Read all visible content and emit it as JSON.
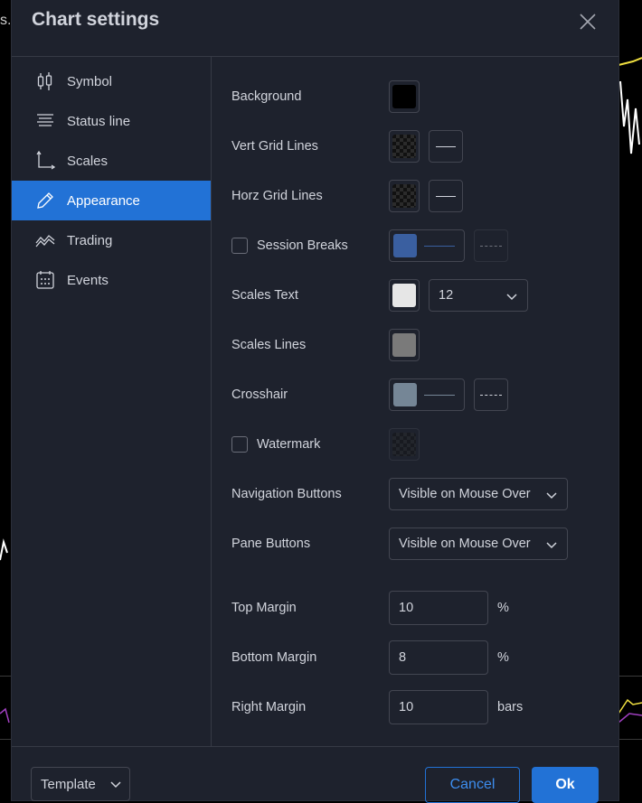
{
  "background_edge_text": "s.c",
  "dialog": {
    "title": "Chart settings"
  },
  "sidebar": {
    "items": [
      {
        "label": "Symbol",
        "icon": "candlestick-icon"
      },
      {
        "label": "Status line",
        "icon": "status-line-icon"
      },
      {
        "label": "Scales",
        "icon": "scales-icon"
      },
      {
        "label": "Appearance",
        "icon": "pencil-icon",
        "active": true
      },
      {
        "label": "Trading",
        "icon": "trading-icon"
      },
      {
        "label": "Events",
        "icon": "calendar-icon"
      }
    ]
  },
  "appearance": {
    "background": {
      "label": "Background",
      "color": "#000000"
    },
    "vert_grid": {
      "label": "Vert Grid Lines"
    },
    "horz_grid": {
      "label": "Horz Grid Lines"
    },
    "session_breaks": {
      "label": "Session Breaks",
      "checked": false,
      "color": "#3a5fa0"
    },
    "scales_text": {
      "label": "Scales Text",
      "color": "#e6e6e6",
      "font_size": "12"
    },
    "scales_lines": {
      "label": "Scales Lines",
      "color": "#7a7a7a"
    },
    "crosshair": {
      "label": "Crosshair",
      "color": "#758696"
    },
    "watermark": {
      "label": "Watermark",
      "checked": false
    },
    "navigation_buttons": {
      "label": "Navigation Buttons",
      "value": "Visible on Mouse Over"
    },
    "pane_buttons": {
      "label": "Pane Buttons",
      "value": "Visible on Mouse Over"
    },
    "top_margin": {
      "label": "Top Margin",
      "value": "10",
      "unit": "%"
    },
    "bottom_margin": {
      "label": "Bottom Margin",
      "value": "8",
      "unit": "%"
    },
    "right_margin": {
      "label": "Right Margin",
      "value": "10",
      "unit": "bars"
    }
  },
  "footer": {
    "template_label": "Template",
    "cancel_label": "Cancel",
    "ok_label": "Ok"
  },
  "colors": {
    "accent": "#2272d6",
    "panel": "#1e222d",
    "border": "#434651"
  }
}
